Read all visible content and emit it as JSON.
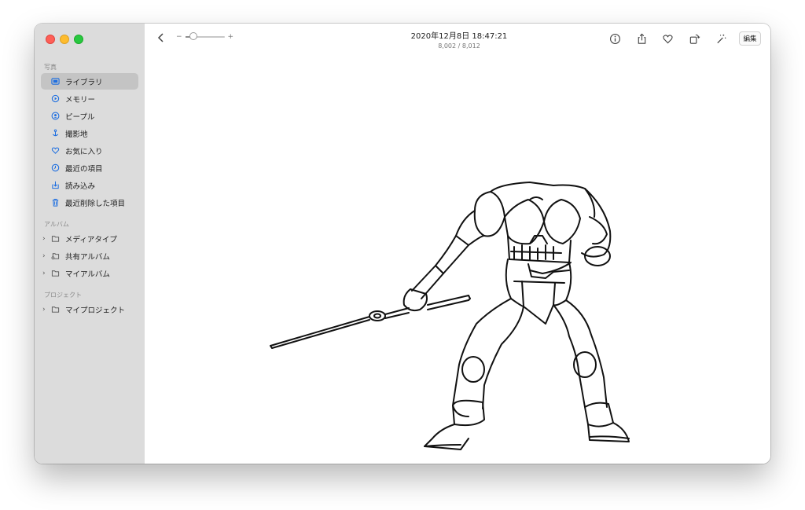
{
  "window": {
    "title": "2020年12月8日 18:47:21",
    "subtitle": "8,002 / 8,012"
  },
  "sidebar": {
    "sections": [
      {
        "title": "写真",
        "items": [
          {
            "label": "ライブラリ",
            "icon": "library-icon",
            "selected": true
          },
          {
            "label": "メモリー",
            "icon": "memories-icon"
          },
          {
            "label": "ピープル",
            "icon": "people-icon"
          },
          {
            "label": "撮影地",
            "icon": "places-icon"
          },
          {
            "label": "お気に入り",
            "icon": "heart-icon"
          },
          {
            "label": "最近の項目",
            "icon": "clock-icon"
          },
          {
            "label": "読み込み",
            "icon": "import-icon"
          },
          {
            "label": "最近削除した項目",
            "icon": "trash-icon"
          }
        ]
      },
      {
        "title": "アルバム",
        "items": [
          {
            "label": "メディアタイプ",
            "icon": "folder-icon"
          },
          {
            "label": "共有アルバム",
            "icon": "shared-folder-icon"
          },
          {
            "label": "マイアルバム",
            "icon": "folder-icon"
          }
        ]
      },
      {
        "title": "プロジェクト",
        "items": [
          {
            "label": "マイプロジェクト",
            "icon": "folder-icon"
          }
        ]
      }
    ]
  },
  "toolbar": {
    "zoom_minus": "−",
    "zoom_plus": "+",
    "zoom_level": 0.2,
    "edit_label": "編集",
    "icons": [
      "info-icon",
      "share-icon",
      "favorite-heart-icon",
      "rotate-icon",
      "enhance-wand-icon"
    ]
  },
  "colors": {
    "sidebar_bg": "#dcdcdc",
    "selection": "#c4c4c4",
    "accent": "#1f6fe0"
  }
}
